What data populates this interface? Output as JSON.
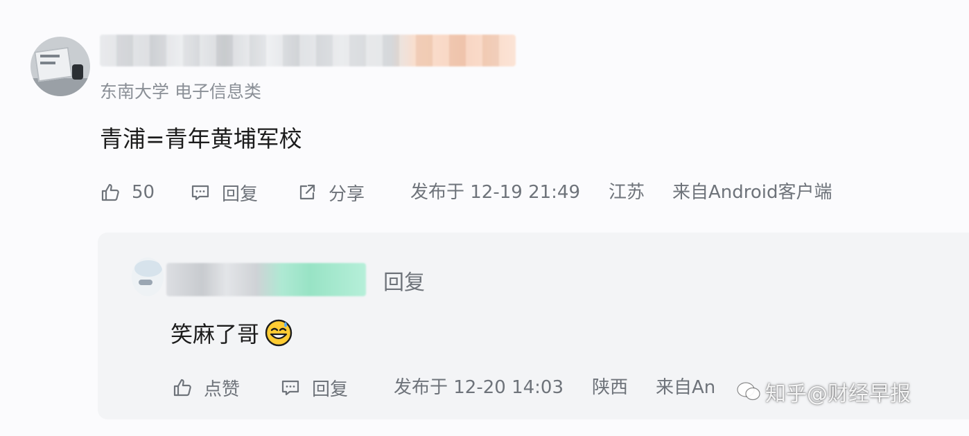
{
  "comment": {
    "school_major": "东南大学 电子信息类",
    "text": "青浦=青年黄埔军校",
    "like_count": "50",
    "reply_label": "回复",
    "share_label": "分享",
    "published_label": "发布于 12-19 21:49",
    "location": "江苏",
    "source": "来自Android客户端"
  },
  "reply": {
    "reply_tag": "回复",
    "text": "笑麻了哥",
    "emoji_icon": "grinning-sweat-emoji-icon",
    "like_label": "点赞",
    "reply_label": "回复",
    "published_label": "发布于 12-20 14:03",
    "location": "陕西",
    "source": "来自An"
  },
  "watermark": {
    "text": "知乎@财经早报"
  },
  "icons": {
    "like": "thumbs-up-icon",
    "reply": "comment-bubble-icon",
    "share": "share-icon"
  },
  "colors": {
    "text_primary": "#1c1c1c",
    "text_secondary": "#6e737a",
    "meta": "#8a8f96",
    "reply_bg": "#f3f4f6"
  }
}
